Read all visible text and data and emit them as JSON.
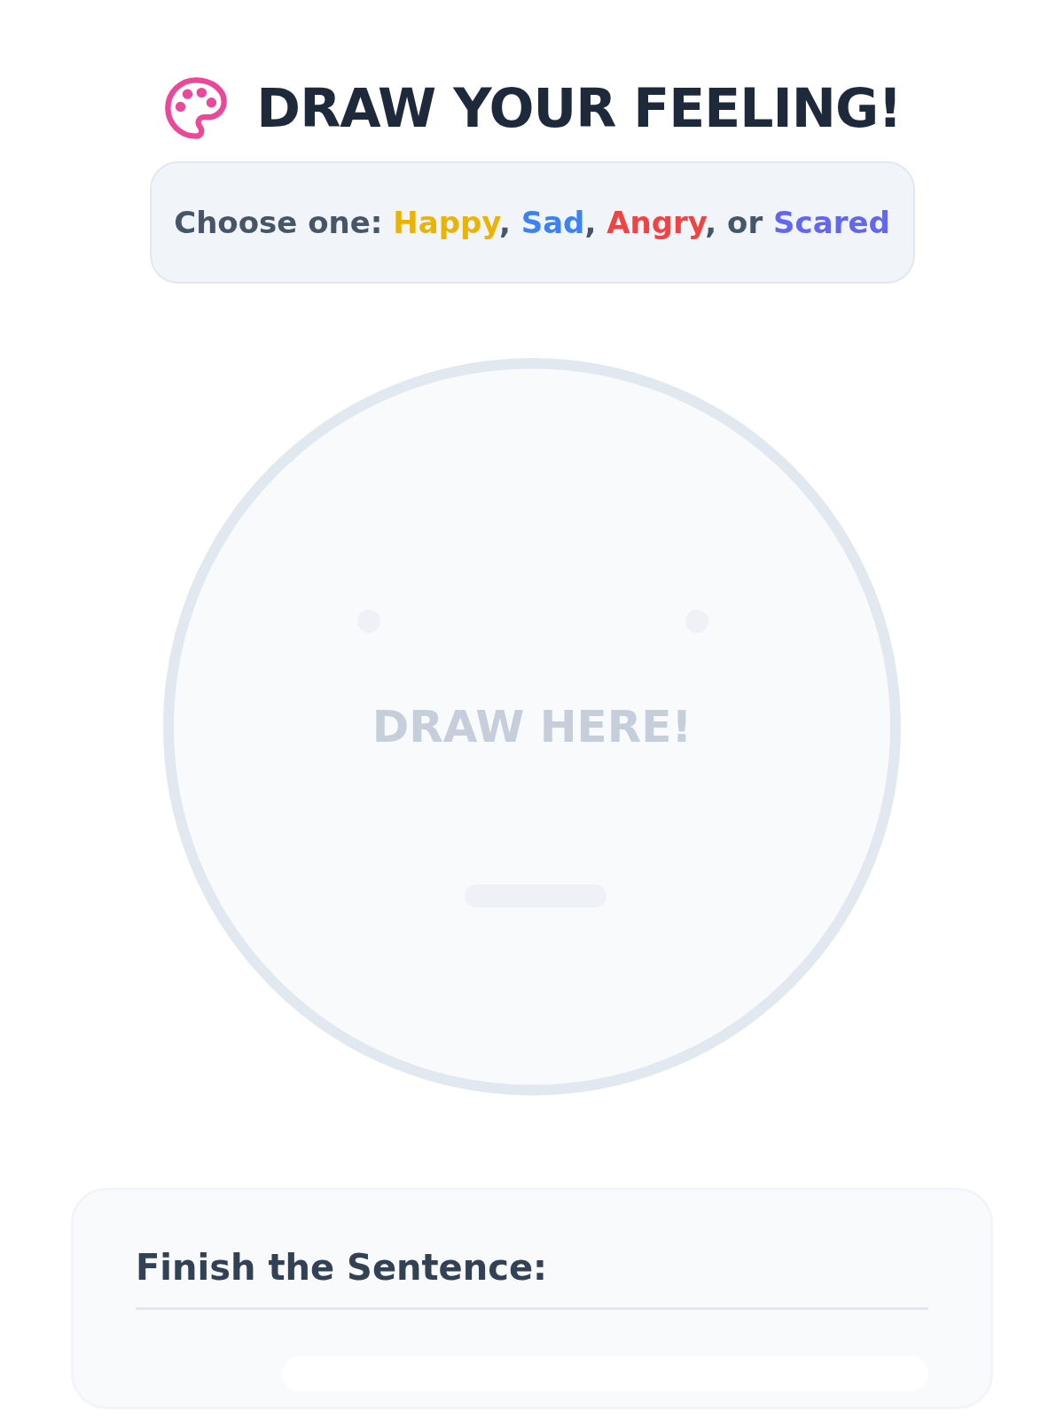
{
  "header": {
    "title": "DRAW YOUR FEELING!"
  },
  "prompt": {
    "segments": [
      {
        "kind": "plain",
        "text": "Choose one: "
      },
      {
        "kind": "emotion",
        "text": "Happy",
        "color": "#eab308"
      },
      {
        "kind": "plain",
        "text": ", "
      },
      {
        "kind": "emotion",
        "text": "Sad",
        "color": "#3b82f6"
      },
      {
        "kind": "plain",
        "text": ", "
      },
      {
        "kind": "emotion",
        "text": "Angry",
        "color": "#ef4444"
      },
      {
        "kind": "plain",
        "text": ", or "
      },
      {
        "kind": "emotion",
        "text": "Scared",
        "color": "#6366f1"
      }
    ]
  },
  "canvas": {
    "placeholder": "DRAW HERE!"
  },
  "sentence_card": {
    "heading": "Finish the Sentence:"
  }
}
